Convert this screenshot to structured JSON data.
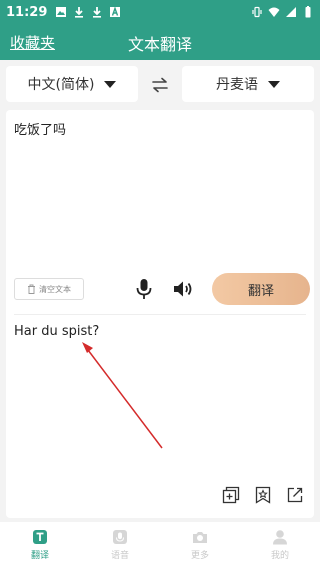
{
  "status": {
    "time": "11:29"
  },
  "header": {
    "favorites": "收藏夹",
    "title": "文本翻译"
  },
  "languages": {
    "source": "中文(简体)",
    "target": "丹麦语"
  },
  "input": {
    "text": "吃饭了吗"
  },
  "controls": {
    "clear": "清空文本",
    "translate": "翻译"
  },
  "output": {
    "text": "Har du spist?"
  },
  "tabs": [
    {
      "label": "翻译",
      "icon": "translate-icon",
      "active": true
    },
    {
      "label": "语音",
      "icon": "microphone-icon",
      "active": false
    },
    {
      "label": "更多",
      "icon": "camera-icon",
      "active": false
    },
    {
      "label": "我的",
      "icon": "person-icon",
      "active": false
    }
  ],
  "colors": {
    "brand": "#2f9f87",
    "button": "#e9b88f",
    "annotation": "#d42b2b"
  }
}
